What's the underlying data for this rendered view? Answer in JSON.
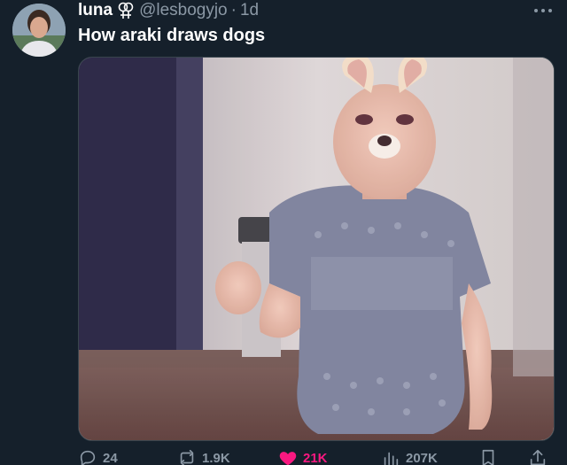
{
  "tweet": {
    "display_name": "luna",
    "handle": "@lesbogyjo",
    "separator": "·",
    "time": "1d",
    "text": "How araki draws dogs"
  },
  "icons": {
    "gender": "female-female-icon",
    "more": "more-icon",
    "reply": "reply-icon",
    "retweet": "retweet-icon",
    "like": "heart-icon",
    "views": "views-icon",
    "bookmark": "bookmark-icon",
    "share": "share-icon"
  },
  "actions": {
    "replies": "24",
    "retweets": "1.9K",
    "likes": "21K",
    "views": "207K"
  },
  "colors": {
    "background": "#15202b",
    "text": "#ffffff",
    "secondary": "#8b98a5",
    "like": "#f91880"
  }
}
